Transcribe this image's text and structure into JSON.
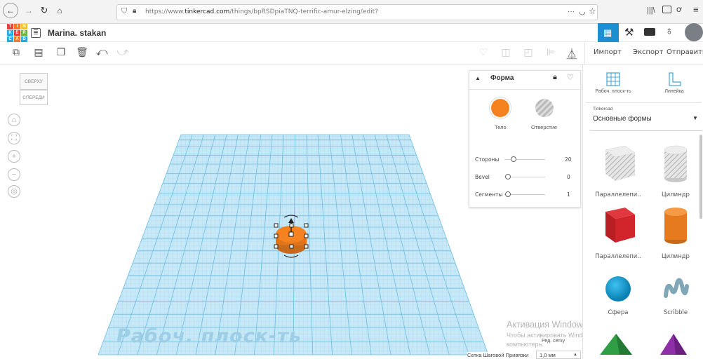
{
  "browser": {
    "url_prefix": "https://www.",
    "url_domain": "tinkercad.com",
    "url_path": "/things/bpRSDpiaTNQ-terrific-amur-elzing/edit?",
    "dots": "···"
  },
  "app": {
    "logo_letters": [
      "T",
      "I",
      "N",
      "K",
      "E",
      "R",
      "C",
      "A",
      "D"
    ],
    "project_name": "Marina. stakan"
  },
  "topbar": {
    "import_label": "Импорт",
    "export_label": "Экспорт",
    "send_label": "Отправить"
  },
  "viewcube": {
    "top": "СВЕРХУ",
    "front": "СПЕРЕДИ"
  },
  "workplane": {
    "watermark": "Рабоч. плоск-ть"
  },
  "shape_panel": {
    "title": "Форма",
    "solid_label": "Тело",
    "hole_label": "Отверстие",
    "solid_color": "#f5821f",
    "params": [
      {
        "label": "Стороны",
        "value": "20",
        "fraction": 0.12
      },
      {
        "label": "Bevel",
        "value": "0",
        "fraction": 0.0
      },
      {
        "label": "Сегменты",
        "value": "1",
        "fraction": 0.0
      }
    ]
  },
  "sidebar": {
    "workplane_label": "Рабоч. плоск-ть",
    "ruler_label": "Линейка",
    "library_source": "Tinkercad",
    "library_name": "Основные формы",
    "shapes": [
      {
        "label": "Параллелепи..",
        "kind": "box-hole"
      },
      {
        "label": "Цилиндр",
        "kind": "cyl-hole"
      },
      {
        "label": "Параллелепи..",
        "kind": "box-red"
      },
      {
        "label": "Цилиндр",
        "kind": "cyl-orange"
      },
      {
        "label": "Сфера",
        "kind": "sphere"
      },
      {
        "label": "Scribble",
        "kind": "scribble"
      }
    ]
  },
  "activation": {
    "title": "Активация Windows",
    "line1": "Чтобы активировать Windows, перейдите к параметрам",
    "line2": "компьютера."
  },
  "grid_settings": {
    "edit_grid_label": "Ред. сетку",
    "snap_label": "Сетка Шаговой Привязки",
    "snap_value": "1,0 мм"
  }
}
